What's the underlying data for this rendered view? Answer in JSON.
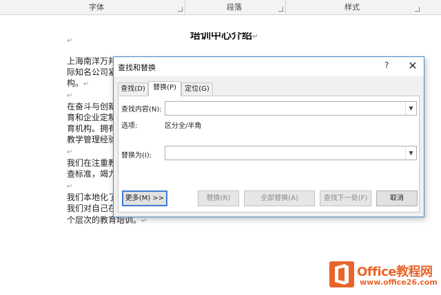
{
  "ribbon": {
    "font_group": "字体",
    "paragraph_group": "段落",
    "styles_group": "样式"
  },
  "document": {
    "title": "培训中心介绍",
    "lines": [
      "上海南洋万邦",
      "际知名公司紧",
      "构。",
      "在奋斗与创新",
      "育和企业定制",
      "育机构。拥有",
      "教学管理经验",
      "我们在注重教",
      "查标准，竭力",
      "我们本地化了",
      "我们对自己在",
      "个层次的教育培训。"
    ],
    "para_mark": "↵"
  },
  "dialog": {
    "title": "查找和替换",
    "help": "?",
    "close": "✕",
    "tabs": [
      "查找(D)",
      "替换(P)",
      "定位(G)"
    ],
    "find_label": "查找内容(N):",
    "find_value": "",
    "options_label": "选项:",
    "options_value": "区分全/半角",
    "replace_label": "替换为(I):",
    "replace_value": "",
    "buttons": {
      "more": "更多(M) >>",
      "replace": "替换(R)",
      "replace_all": "全部替换(A)",
      "find_next": "查找下一处(F)",
      "cancel": "取消"
    }
  },
  "watermark": {
    "brand": "Office教程网",
    "url": "www.office26.com"
  },
  "colors": {
    "accent": "#4a87c8",
    "brand": "#e8642a"
  }
}
